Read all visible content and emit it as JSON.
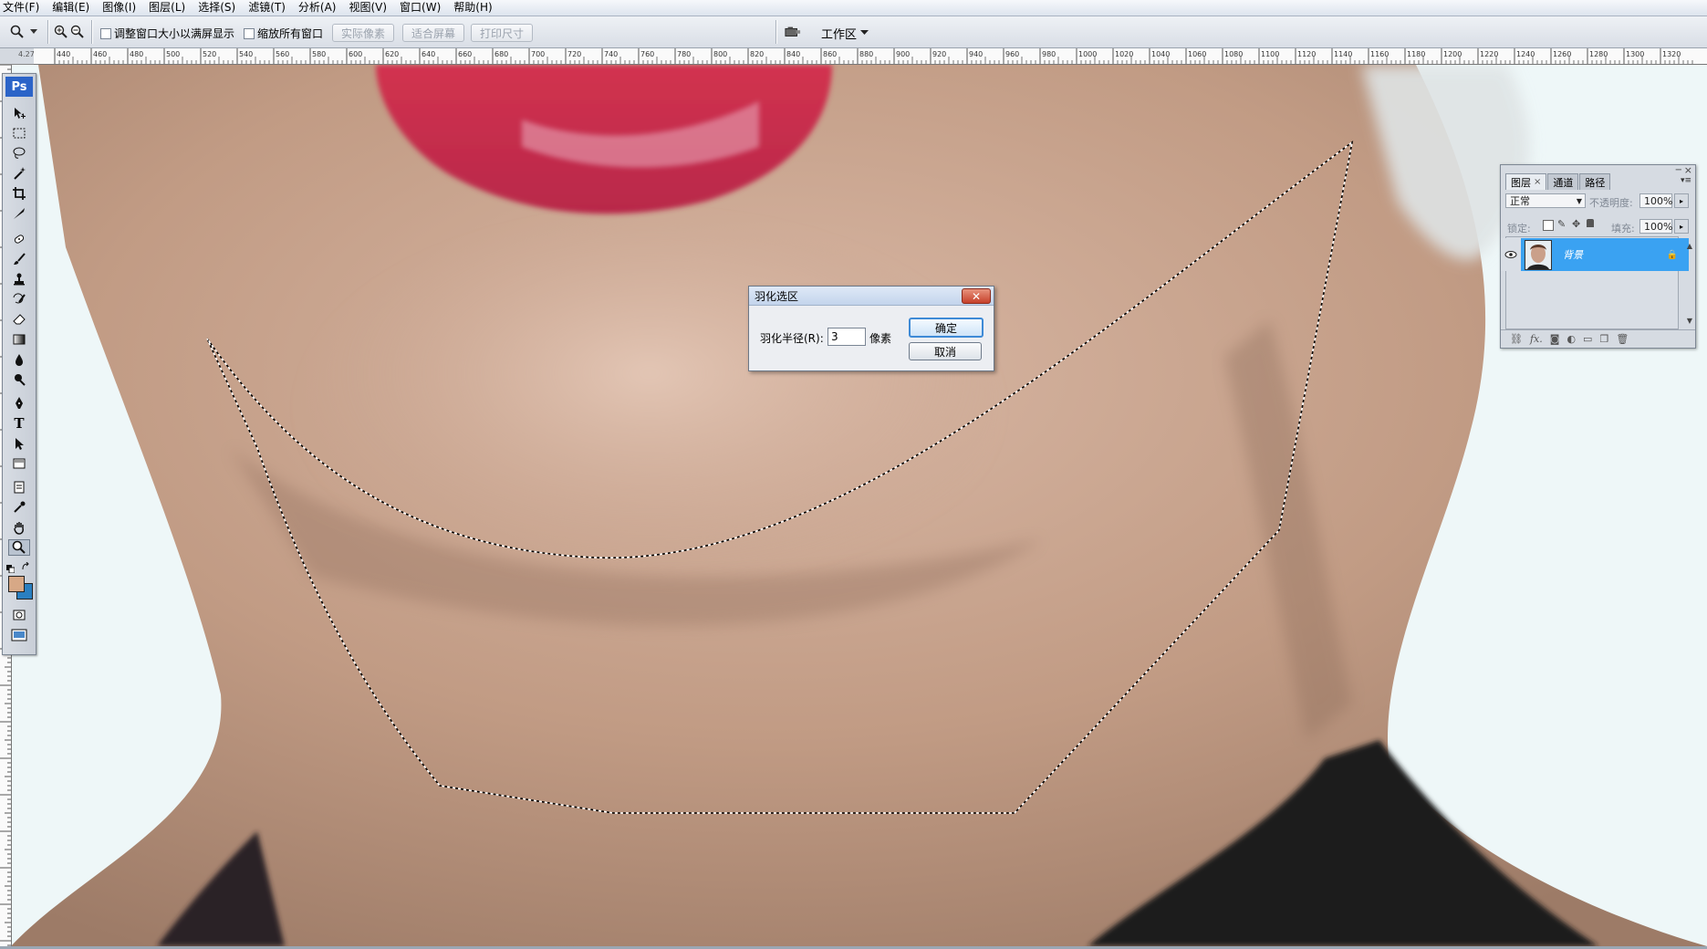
{
  "menubar": {
    "items": [
      "文件(F)",
      "编辑(E)",
      "图像(I)",
      "图层(L)",
      "选择(S)",
      "滤镜(T)",
      "分析(A)",
      "视图(V)",
      "窗口(W)",
      "帮助(H)"
    ]
  },
  "options": {
    "checkbox_resize": "调整窗口大小以满屏显示",
    "checkbox_zoom_all": "缩放所有窗口",
    "btn_actual_pixels": "实际像素",
    "btn_fit_screen": "适合屏幕",
    "btn_print_size": "打印尺寸",
    "workspace": "工作区"
  },
  "ruler": {
    "corner": "4.27",
    "ticks": [
      "440",
      "460",
      "480",
      "500",
      "520",
      "540",
      "560",
      "580",
      "600",
      "620",
      "640",
      "660",
      "680",
      "700",
      "720",
      "740",
      "760",
      "780",
      "800",
      "820",
      "840",
      "860",
      "880",
      "900",
      "920",
      "940",
      "960",
      "980",
      "1000",
      "1020",
      "1040",
      "1060",
      "1080",
      "1100",
      "1120",
      "1140",
      "1160",
      "1180",
      "1200",
      "1220",
      "1240",
      "1260",
      "1280",
      "1300",
      "1320"
    ]
  },
  "toolbox": {
    "logo": "Ps",
    "tools": [
      "move-tool",
      "marquee-tool",
      "lasso-tool",
      "magic-wand-tool",
      "crop-tool",
      "slice-tool",
      "healing-brush-tool",
      "brush-tool",
      "clone-stamp-tool",
      "history-brush-tool",
      "eraser-tool",
      "gradient-tool",
      "blur-tool",
      "dodge-tool",
      "pen-tool",
      "type-tool",
      "path-selection-tool",
      "shape-tool",
      "notes-tool",
      "eyedropper-tool",
      "hand-tool",
      "zoom-tool"
    ],
    "foreground_color": "#d7a886",
    "background_color": "#2a7fc0"
  },
  "layers_panel": {
    "tabs": [
      "图层",
      "通道",
      "路径"
    ],
    "blend_mode": "正常",
    "opacity_label": "不透明度:",
    "opacity_value": "100%",
    "lock_label": "锁定:",
    "fill_label": "填充:",
    "fill_value": "100%",
    "layer_name": "背景"
  },
  "dialog": {
    "title": "羽化选区",
    "radius_label": "羽化半径(R):",
    "radius_value": "3",
    "unit": "像素",
    "ok": "确定",
    "cancel": "取消"
  }
}
